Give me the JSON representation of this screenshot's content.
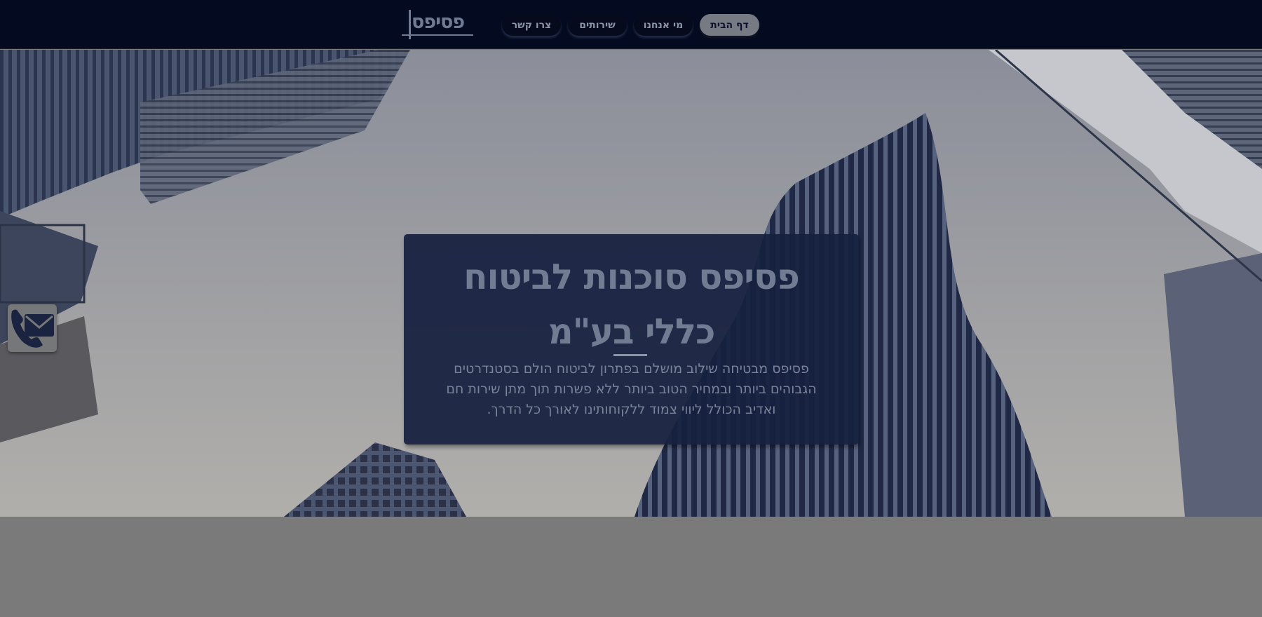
{
  "header": {
    "logo_text": "פסיפס",
    "nav": [
      {
        "label": "צרו קשר"
      },
      {
        "label": "שירותים"
      },
      {
        "label": "מי אנחנו"
      },
      {
        "label": "דף הבית",
        "active": true
      }
    ]
  },
  "hero": {
    "title": "פסיפס סוכנות לביטוח כללי בע\"מ",
    "description": "פסיפס מבטיחה שילוב מושלם בפתרון לביטוח הולם בסטנדרטים הגבוהים ביותר ובמחיר הטוב ביותר ללא פשרות תוך מתן שירות חם ואדיב הכולל ליווי צמוד ללקוחותינו לאורך כל הדרך."
  },
  "contact_widget": {
    "icon": "phone-mail-icon"
  },
  "colors": {
    "header_bg": "#040b20",
    "card_bg": "#161f3e",
    "active_nav_bg": "#767a82",
    "text_muted": "#717c93"
  }
}
